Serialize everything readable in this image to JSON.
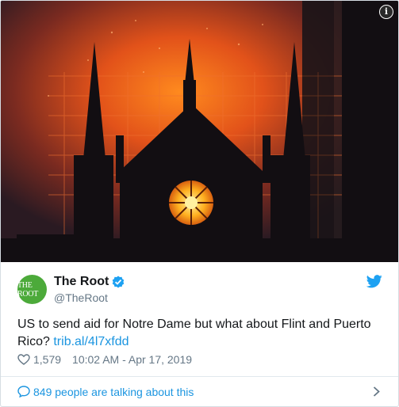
{
  "tweet": {
    "display_name": "The Root",
    "handle": "@TheRoot",
    "avatar_text": "THE ROOT",
    "text": "US to send aid for Notre Dame but what about Flint and Puerto Rico? ",
    "link": "trib.al/4l7xfdd",
    "likes": "1,579",
    "timestamp": "10:02 AM - Apr 17, 2019",
    "footer": "849 people are talking about this",
    "info_glyph": "i"
  },
  "colors": {
    "accent": "#1b95e0",
    "avatar_bg": "#4caa3a",
    "text": "#14171a",
    "muted": "#657786"
  },
  "icons": [
    "info-icon",
    "verified-badge-icon",
    "twitter-bird-icon",
    "heart-icon",
    "speech-bubble-icon",
    "chevron-right-icon"
  ]
}
